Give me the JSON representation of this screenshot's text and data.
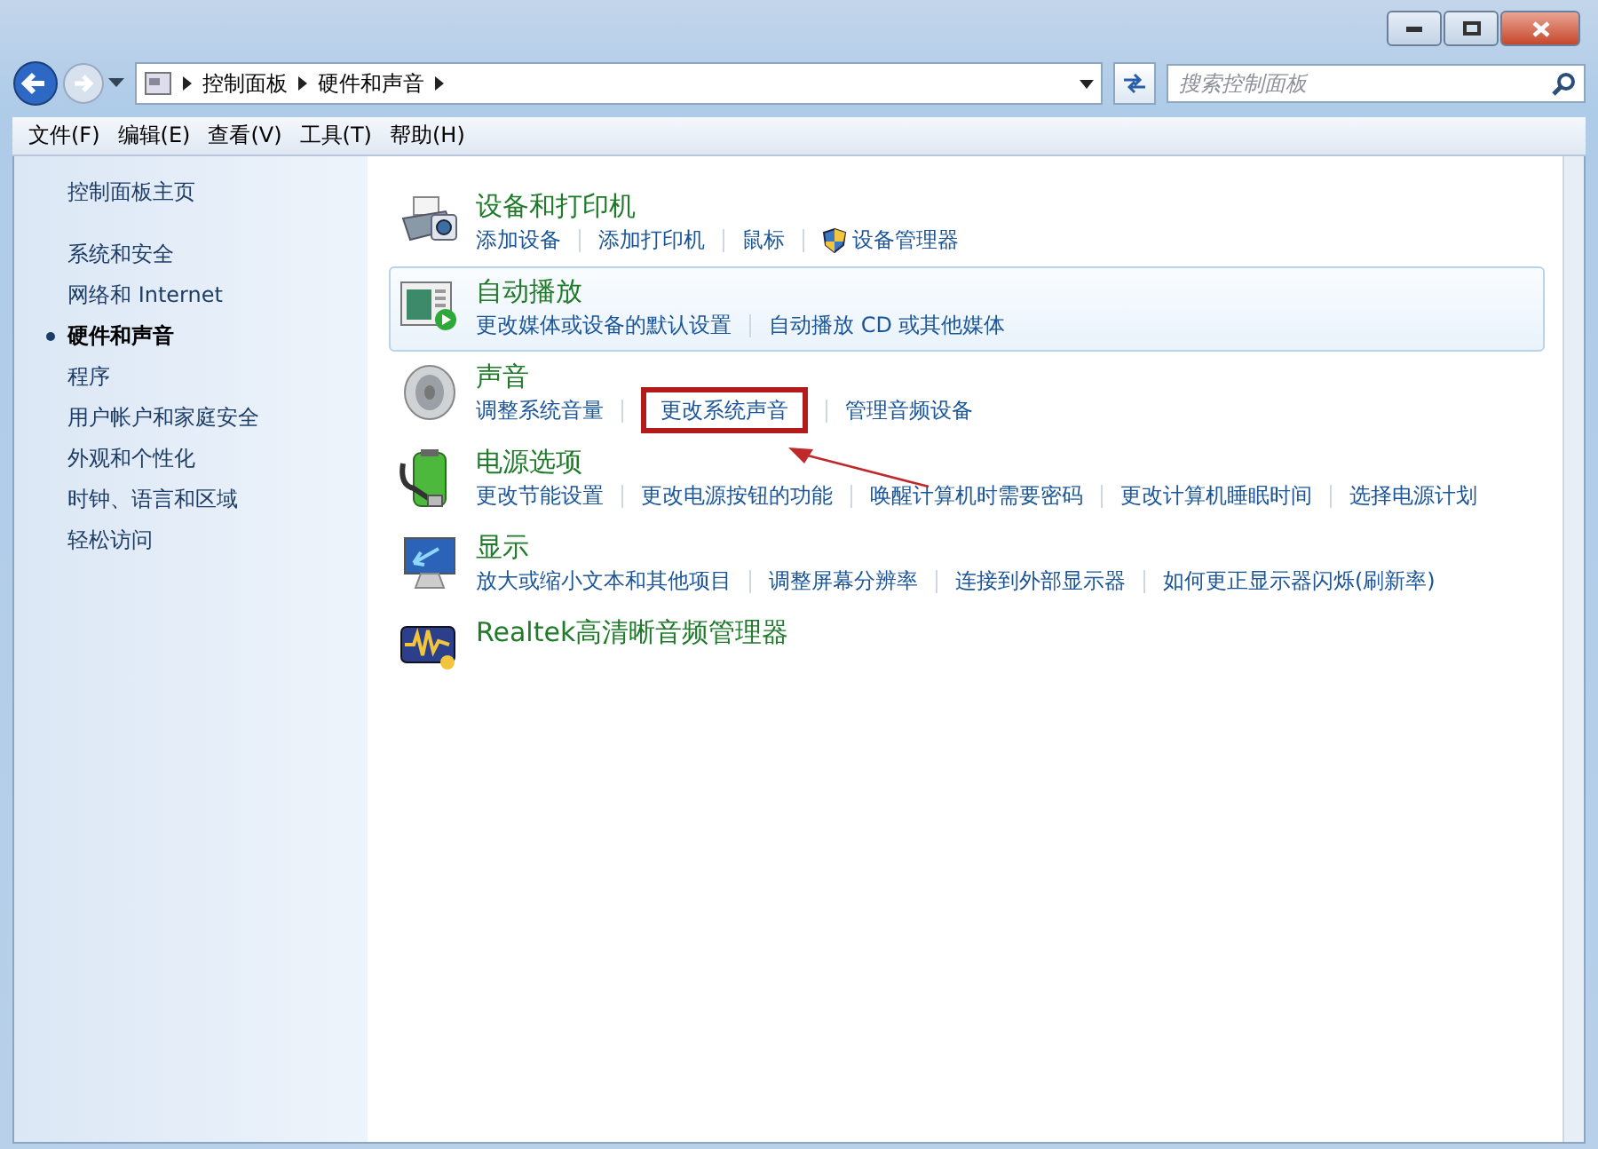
{
  "address_bar": {
    "breadcrumbs": [
      "控制面板",
      "硬件和声音"
    ]
  },
  "search": {
    "placeholder": "搜索控制面板"
  },
  "menu": [
    "文件(F)",
    "编辑(E)",
    "查看(V)",
    "工具(T)",
    "帮助(H)"
  ],
  "sidebar": {
    "home": "控制面板主页",
    "items": [
      {
        "label": "系统和安全",
        "selected": false
      },
      {
        "label": "网络和 Internet",
        "selected": false
      },
      {
        "label": "硬件和声音",
        "selected": true
      },
      {
        "label": "程序",
        "selected": false
      },
      {
        "label": "用户帐户和家庭安全",
        "selected": false
      },
      {
        "label": "外观和个性化",
        "selected": false
      },
      {
        "label": "时钟、语言和区域",
        "selected": false
      },
      {
        "label": "轻松访问",
        "selected": false
      }
    ]
  },
  "categories": [
    {
      "title": "设备和打印机",
      "kind": "printer",
      "highlighted": false,
      "links": [
        {
          "label": "添加设备",
          "shield": false,
          "annotated": false
        },
        {
          "label": "添加打印机",
          "shield": false,
          "annotated": false
        },
        {
          "label": "鼠标",
          "shield": false,
          "annotated": false
        },
        {
          "label": "设备管理器",
          "shield": true,
          "annotated": false
        }
      ]
    },
    {
      "title": "自动播放",
      "kind": "autoplay",
      "highlighted": true,
      "links": [
        {
          "label": "更改媒体或设备的默认设置",
          "shield": false,
          "annotated": false
        },
        {
          "label": "自动播放 CD 或其他媒体",
          "shield": false,
          "annotated": false
        }
      ]
    },
    {
      "title": "声音",
      "kind": "speaker",
      "highlighted": false,
      "links": [
        {
          "label": "调整系统音量",
          "shield": false,
          "annotated": false
        },
        {
          "label": "更改系统声音",
          "shield": false,
          "annotated": true
        },
        {
          "label": "管理音频设备",
          "shield": false,
          "annotated": false
        }
      ]
    },
    {
      "title": "电源选项",
      "kind": "battery",
      "highlighted": false,
      "links": [
        {
          "label": "更改节能设置",
          "shield": false,
          "annotated": false
        },
        {
          "label": "更改电源按钮的功能",
          "shield": false,
          "annotated": false
        },
        {
          "label": "唤醒计算机时需要密码",
          "shield": false,
          "annotated": false
        },
        {
          "label": "更改计算机睡眠时间",
          "shield": false,
          "annotated": false
        },
        {
          "label": "选择电源计划",
          "shield": false,
          "annotated": false
        }
      ]
    },
    {
      "title": "显示",
      "kind": "monitor",
      "highlighted": false,
      "links": [
        {
          "label": "放大或缩小文本和其他项目",
          "shield": false,
          "annotated": false
        },
        {
          "label": "调整屏幕分辨率",
          "shield": false,
          "annotated": false
        },
        {
          "label": "连接到外部显示器",
          "shield": false,
          "annotated": false
        },
        {
          "label": "如何更正显示器闪烁(刷新率)",
          "shield": false,
          "annotated": false
        }
      ]
    },
    {
      "title": "Realtek高清晰音频管理器",
      "kind": "audio-manager",
      "highlighted": false
    }
  ]
}
